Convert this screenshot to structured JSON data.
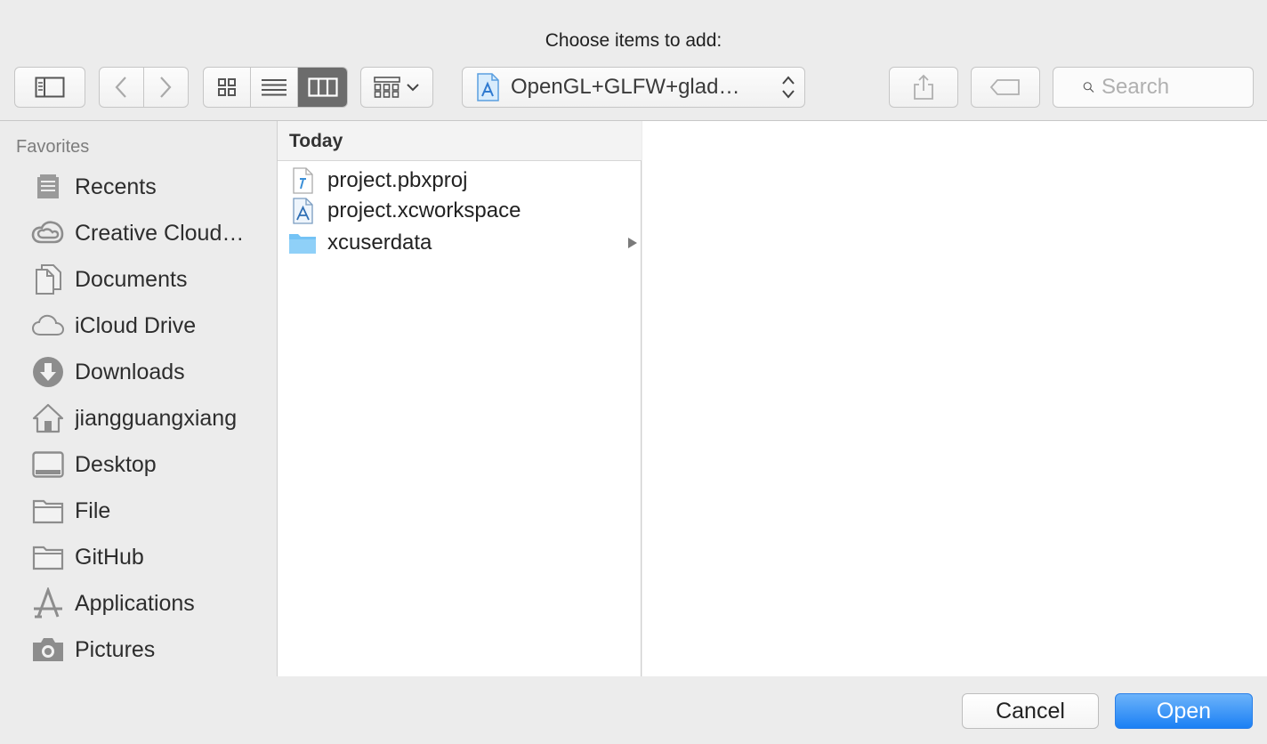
{
  "dialog": {
    "title": "Choose items to add:"
  },
  "toolbar": {
    "path_label": "OpenGL+GLFW+glad…",
    "search_placeholder": "Search",
    "view_modes": [
      "icon",
      "list",
      "column"
    ],
    "active_view": "column"
  },
  "sidebar": {
    "section_title": "Favorites",
    "items": [
      {
        "label": "Recents",
        "icon": "recents-icon"
      },
      {
        "label": "Creative Cloud…",
        "icon": "creative-cloud-icon"
      },
      {
        "label": "Documents",
        "icon": "documents-icon"
      },
      {
        "label": "iCloud Drive",
        "icon": "icloud-icon"
      },
      {
        "label": "Downloads",
        "icon": "downloads-icon"
      },
      {
        "label": "jiangguangxiang",
        "icon": "home-icon"
      },
      {
        "label": "Desktop",
        "icon": "desktop-icon"
      },
      {
        "label": "File",
        "icon": "folder-icon"
      },
      {
        "label": "GitHub",
        "icon": "folder-icon"
      },
      {
        "label": "Applications",
        "icon": "applications-icon"
      },
      {
        "label": "Pictures",
        "icon": "camera-icon"
      }
    ]
  },
  "browser": {
    "column_header": "Today",
    "files": [
      {
        "name": "project.pbxproj",
        "icon": "pbxproj-file-icon",
        "has_children": false
      },
      {
        "name": "project.xcworkspace",
        "icon": "xcworkspace-file-icon",
        "has_children": false
      },
      {
        "name": "xcuserdata",
        "icon": "folder-icon",
        "has_children": true
      }
    ]
  },
  "buttons": {
    "cancel": "Cancel",
    "open": "Open"
  },
  "colors": {
    "accent": "#1b80f4",
    "window_bg": "#ececec",
    "active_segment": "#6c6c6c"
  }
}
